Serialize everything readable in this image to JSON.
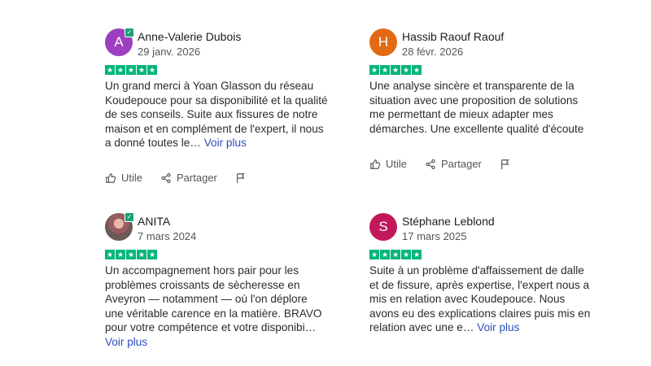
{
  "reviews": [
    {
      "name": "Anne-Valerie Dubois",
      "date": "29 janv. 2026",
      "avatar_letter": "A",
      "avatar_color": "#9c3fc0",
      "rating": 5,
      "text": "Un grand merci à Yoan Glasson du réseau Koudepouce pour sa disponibilité et la qualité de ses conseils. Suite aux fissures de notre maison et en complément de l'expert, il nous a donné toutes le…",
      "more": "Voir plus",
      "has_actions": true
    },
    {
      "name": "Hassib Raouf Raouf",
      "date": "28 févr. 2026",
      "avatar_letter": "H",
      "avatar_color": "#e26a14",
      "rating": 5,
      "text": "Une analyse sincère et transparente de la situation avec une proposition de solutions me permettant de mieux adapter mes démarches. Une excellente qualité d'écoute",
      "more": "",
      "has_actions": true
    },
    {
      "name": "ANITA",
      "date": "7 mars 2024",
      "avatar_letter": "",
      "avatar_color": "photo",
      "rating": 5,
      "text": "Un accompagnement hors pair pour les problèmes croissants de sècheresse en Aveyron — notamment — où l'on déplore une véritable carence en la matière. BRAVO pour votre compétence et votre disponibi…",
      "more": "Voir plus",
      "has_actions": false
    },
    {
      "name": "Stéphane Leblond",
      "date": "17 mars 2025",
      "avatar_letter": "S",
      "avatar_color": "#c2185b",
      "rating": 5,
      "text": "Suite à un problème d'affaissement de dalle et de fissure, après expertise, l'expert nous a mis en relation avec Koudepouce. Nous avons eu des explications claires puis mis en relation avec une e…",
      "more": "Voir plus",
      "has_actions": false
    }
  ],
  "actions": {
    "useful_label": "Utile",
    "share_label": "Partager",
    "useful_icon": "thumbs-up-icon",
    "share_icon": "share-icon",
    "flag_icon": "flag-icon"
  },
  "colors": {
    "star_green": "#00b67a",
    "link_blue": "#2d4dbf"
  }
}
